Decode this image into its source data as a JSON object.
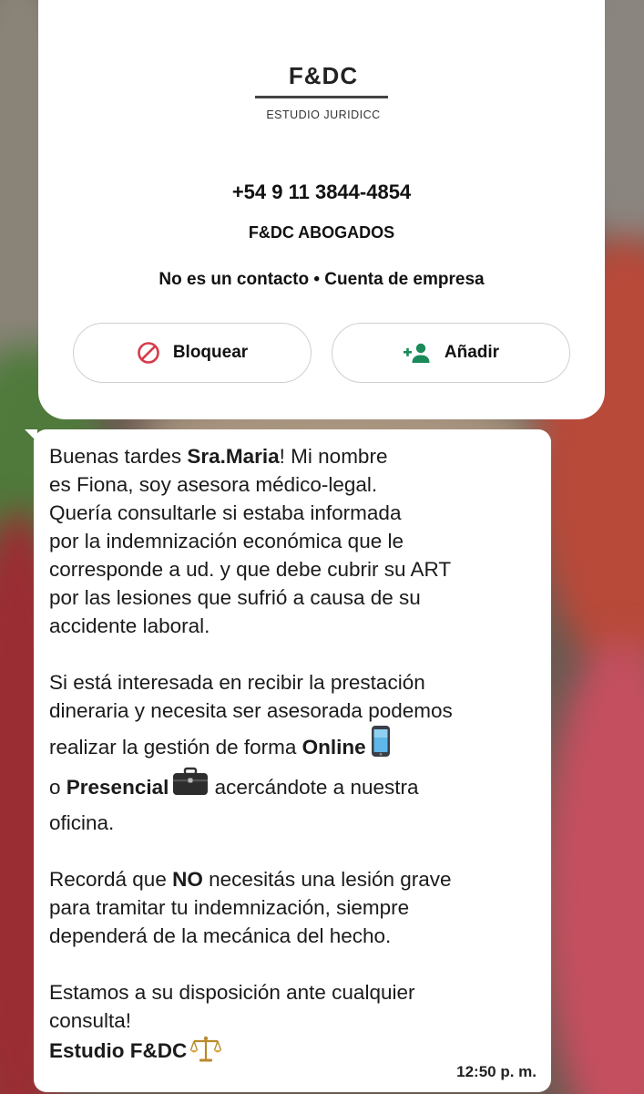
{
  "contact": {
    "logo_title": "F&DC",
    "logo_subtitle": "ESTUDIO JURIDICC",
    "phone": "+54 9 11 3844-4854",
    "business_name": "F&DC ABOGADOS",
    "status": "No es un contacto • Cuenta de empresa",
    "block_label": "Bloquear",
    "add_label": "Añadir",
    "block_icon": "block-icon",
    "add_icon": "add-person-icon",
    "block_icon_color": "#d93a4a",
    "add_icon_color": "#1a8a5a"
  },
  "message": {
    "p1": {
      "l1a": "Buenas tardes ",
      "l1b": "Sra.Maria",
      "l1c": "! Mi nombre",
      "l2": "es Fiona, soy asesora médico-legal.",
      "l3": "Quería consultarle si estaba informada",
      "l4": "por la indemnización económica que le",
      "l5": "corresponde a ud. y que debe cubrir su ART",
      "l6": "por las lesiones que sufrió a causa de su",
      "l7": "accidente laboral."
    },
    "p2": {
      "l1": "Si está interesada en recibir la prestación",
      "l2": "dineraria y necesita ser asesorada podemos",
      "l3a": "realizar la gestión de forma ",
      "l3b": "Online",
      "l3_icon": "mobile-phone-icon",
      "l4a": "o ",
      "l4b": "Presencial",
      "l4_icon": "briefcase-icon",
      "l4c": " acercándote a nuestra",
      "l5": "oficina."
    },
    "p3": {
      "l1a": "Recordá que ",
      "l1b": "NO",
      "l1c": " necesitás una lesión grave",
      "l2": "para tramitar tu indemnización, siempre",
      "l3": "dependerá de la mecánica del hecho."
    },
    "p4": {
      "l1": "Estamos a su disposición ante cualquier",
      "l2": "consulta!",
      "signature": "Estudio F&DC",
      "signature_icon": "scales-icon"
    },
    "timestamp": "12:50 p. m."
  }
}
